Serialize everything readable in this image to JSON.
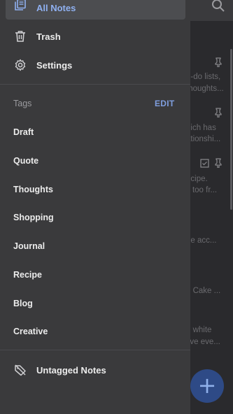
{
  "background": {
    "snippets": [
      "o-do lists,",
      "thoughts...",
      "hich has",
      "ationshi...",
      "ecipe.",
      "s too fr...",
      "e",
      "be acc...",
      "n Cake ...",
      "e white",
      "I've eve..."
    ]
  },
  "drawer": {
    "nav": [
      {
        "label": "All Notes",
        "icon": "notes-icon"
      },
      {
        "label": "Trash",
        "icon": "trash-icon"
      },
      {
        "label": "Settings",
        "icon": "gear-icon"
      }
    ],
    "tags_header": "Tags",
    "edit_label": "EDIT",
    "tags": [
      "Draft",
      "Quote",
      "Thoughts",
      "Shopping",
      "Journal",
      "Recipe",
      "Blog",
      "Creative"
    ],
    "untagged_label": "Untagged Notes"
  },
  "fab": {
    "label": "+"
  },
  "colors": {
    "accent": "#8fb0f0",
    "drawer_bg": "#3a3a3c",
    "fab": "#2e4a86"
  }
}
